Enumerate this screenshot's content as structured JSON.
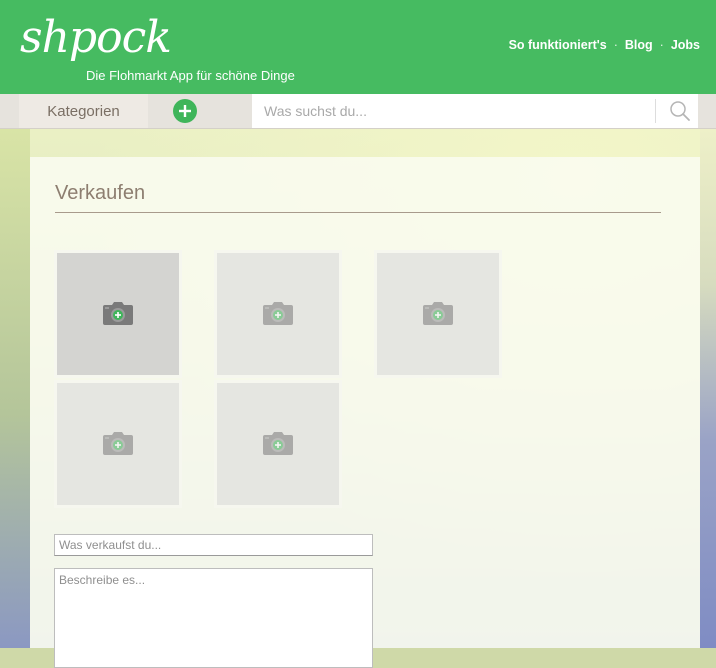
{
  "header": {
    "logo": "shpock",
    "tagline": "Die Flohmarkt App für schöne Dinge",
    "nav": [
      {
        "label": "So funktioniert's"
      },
      {
        "label": "Blog"
      },
      {
        "label": "Jobs"
      }
    ],
    "nav_separator": "·"
  },
  "toolbar": {
    "categories_label": "Kategorien",
    "add_icon": "plus-circle-icon",
    "search_placeholder": "Was suchst du...",
    "search_icon": "search-icon"
  },
  "sell_form": {
    "title": "Verkaufen",
    "photo_slots": [
      {
        "icon": "camera-add-icon",
        "primary": true
      },
      {
        "icon": "camera-add-icon",
        "primary": false
      },
      {
        "icon": "camera-add-icon",
        "primary": false
      },
      {
        "icon": "camera-add-icon",
        "primary": false
      },
      {
        "icon": "camera-add-icon",
        "primary": false
      }
    ],
    "title_placeholder": "Was verkaufst du...",
    "description_placeholder": "Beschreibe es..."
  },
  "colors": {
    "brand_green": "#46bb61",
    "add_button_green": "#3fb55a",
    "toolbar_bg": "#e6e3dd",
    "title_color": "#8d7e70"
  }
}
